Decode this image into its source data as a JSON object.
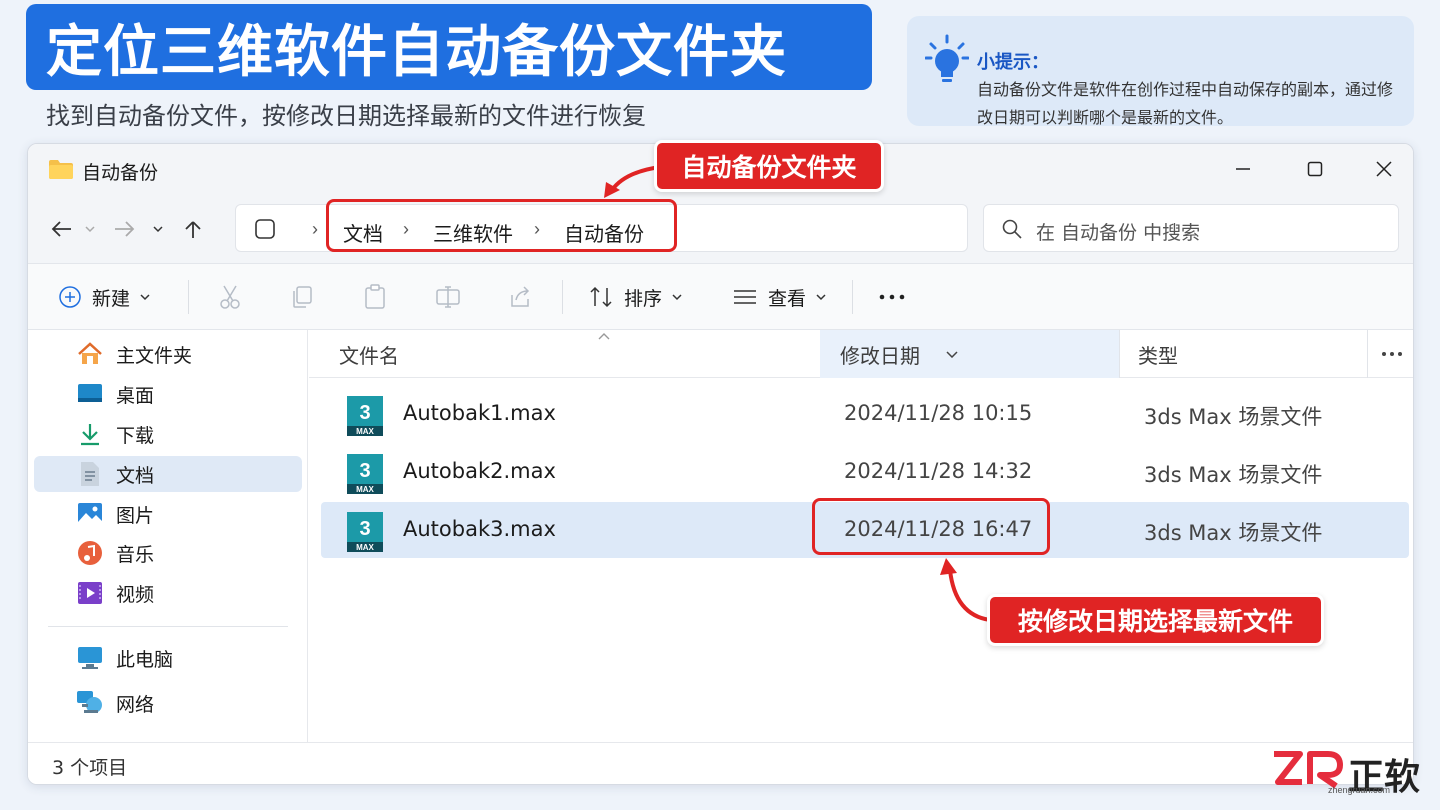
{
  "banner": {
    "title": "定位三维软件自动备份文件夹",
    "subtitle": "找到自动备份文件，按修改日期选择最新的文件进行恢复"
  },
  "tip": {
    "title": "小提示：",
    "text": "自动备份文件是软件在创作过程中自动保存的副本，通过修改日期可以判断哪个是最新的文件。"
  },
  "window": {
    "title": "自动备份",
    "breadcrumbs": [
      "文档",
      "三维软件",
      "自动备份"
    ],
    "search_placeholder": "在 自动备份 中搜索",
    "toolbar": {
      "new_label": "新建",
      "sort_label": "排序",
      "view_label": "查看"
    },
    "sidebar": [
      {
        "label": "主文件夹",
        "icon": "home-icon"
      },
      {
        "label": "桌面",
        "icon": "desktop-icon"
      },
      {
        "label": "下载",
        "icon": "download-icon"
      },
      {
        "label": "文档",
        "icon": "document-icon",
        "selected": true
      },
      {
        "label": "图片",
        "icon": "picture-icon"
      },
      {
        "label": "音乐",
        "icon": "music-icon"
      },
      {
        "label": "视频",
        "icon": "video-icon"
      },
      {
        "label": "此电脑",
        "icon": "computer-icon"
      },
      {
        "label": "网络",
        "icon": "network-icon"
      }
    ],
    "columns": {
      "name": "文件名",
      "date": "修改日期",
      "type": "类型"
    },
    "files": [
      {
        "name": "Autobak1.max",
        "date": "2024/11/28  10:15",
        "type": "3ds Max 场景文件"
      },
      {
        "name": "Autobak2.max",
        "date": "2024/11/28  14:32",
        "type": "3ds Max 场景文件"
      },
      {
        "name": "Autobak3.max",
        "date": "2024/11/28  16:47",
        "type": "3ds Max 场景文件",
        "selected": true
      }
    ],
    "file_icon_text": {
      "num": "3",
      "ext": "MAX"
    },
    "status": "3 个项目"
  },
  "annotations": {
    "folder_callout": "自动备份文件夹",
    "date_callout": "按修改日期选择最新文件"
  },
  "logo": {
    "brand": "正软",
    "url": "zhengruan.com"
  },
  "colors": {
    "accent": "#1f6fe0",
    "highlight": "#e02424",
    "selection": "#dde9f8"
  }
}
